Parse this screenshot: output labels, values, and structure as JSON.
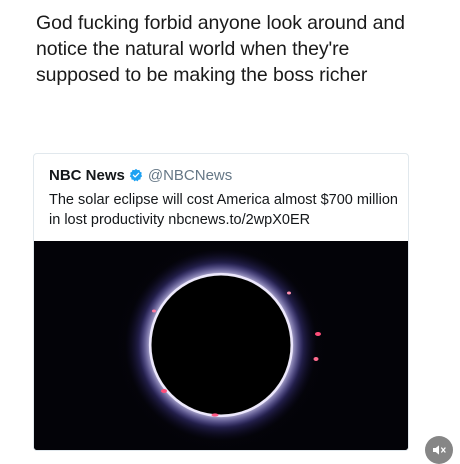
{
  "caption": {
    "text": "God fucking forbid anyone look around and notice the natural world when they're supposed to be making the boss richer"
  },
  "tweet": {
    "author_name": "NBC News",
    "verified": true,
    "handle": "@NBCNews",
    "text": "The solar eclipse will cost America almost $700 million in lost productivity nbcnews.to/2wpX0ER",
    "media": {
      "subject": "solar eclipse corona",
      "background_color": "#030308",
      "corona_color": "#c9c2ff",
      "prominence_color": "#ff4d7a"
    }
  },
  "controls": {
    "mute_icon": "speaker-muted-icon"
  },
  "colors": {
    "verified_blue": "#1da1f2",
    "handle_gray": "#657786",
    "text_dark": "#14171a"
  }
}
